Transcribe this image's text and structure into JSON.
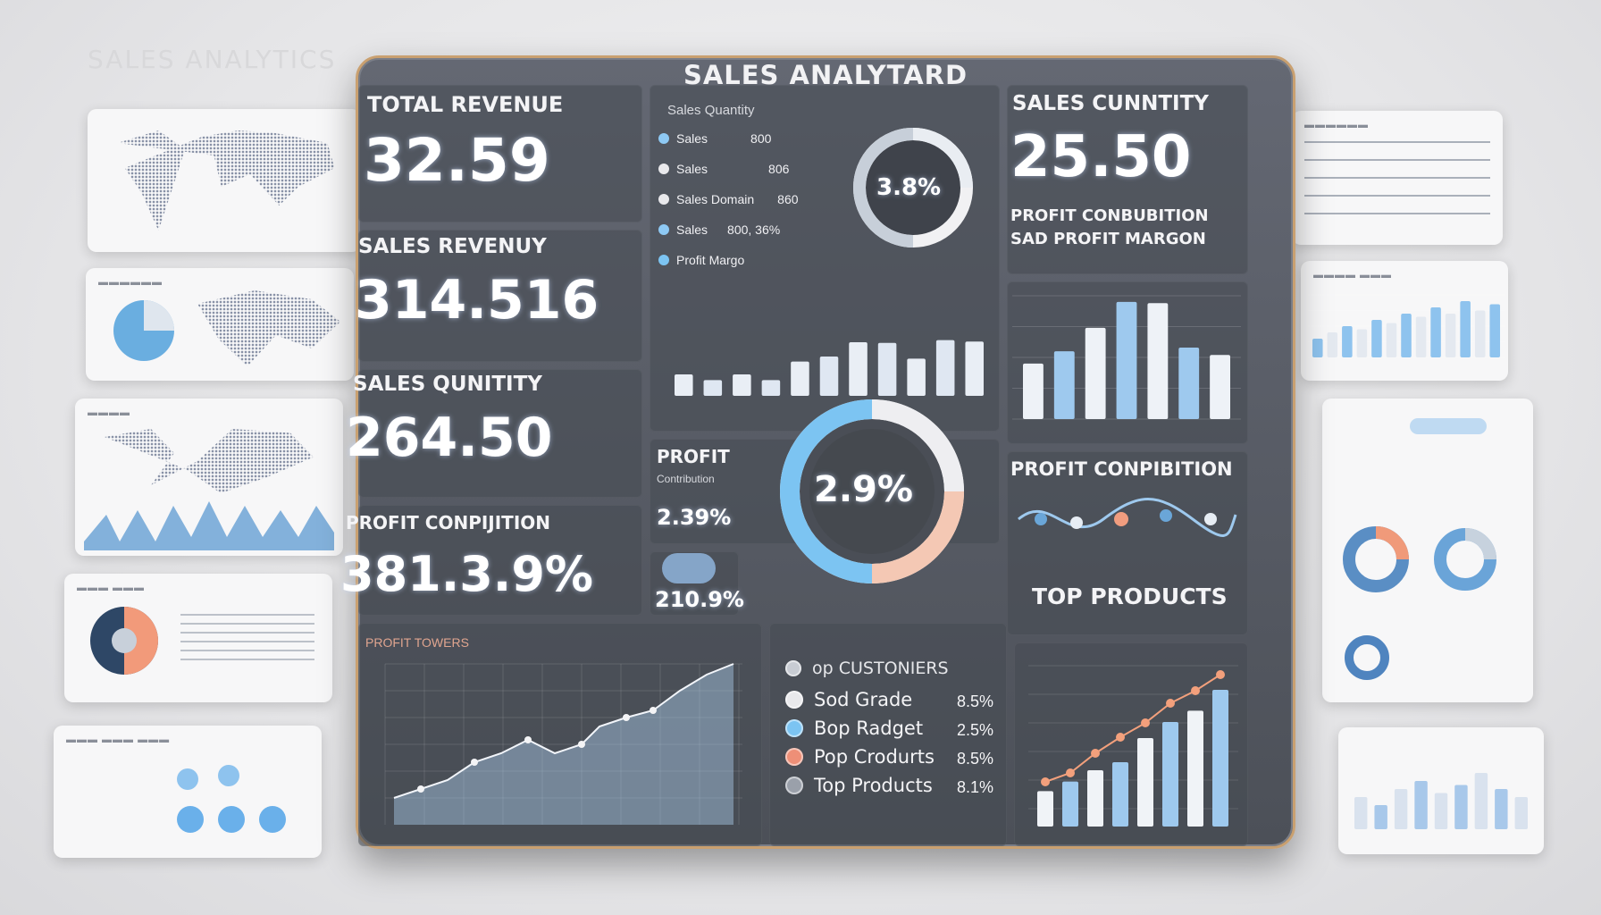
{
  "background_title": "SALES ANALYTICS",
  "dashboard": {
    "title": "SALES ANALYTARD",
    "kpis": [
      {
        "label": "TOTAL REVENUE",
        "value": "32.59"
      },
      {
        "label": "SALES REVENUY",
        "value": "314.516"
      },
      {
        "label": "SALES QUNITITY",
        "value": "264.50"
      },
      {
        "label": "PROFIT CONPIJITION",
        "value": "381.3.9%"
      }
    ],
    "sales_quantity_panel": {
      "heading": "Sales Quantity",
      "rows": [
        {
          "label": "Sales",
          "value": "800"
        },
        {
          "label": "Sales",
          "value": "806"
        },
        {
          "label": "Sales Domain",
          "value": "860"
        },
        {
          "label": "Sales",
          "value": "800, 36%"
        }
      ],
      "footer": "Profit Margo",
      "donut_value": "3.8%"
    },
    "right_kpi": {
      "label": "SALES CUNNTITY",
      "value": "25.50",
      "sub1": "PROFIT CONBUBITION",
      "sub2": "SAD PROFIT MARGON"
    },
    "profit_panel": {
      "label": "PROFIT",
      "sub": "Contribution",
      "value1": "2.39%",
      "value2": "210.9%",
      "donut_value": "2.9%"
    },
    "profit_compilation_label": "PROFIT CONPIBITION",
    "top_products_label": "TOP PRODUCTS",
    "line_chart_title": "PROFIT TOWERS",
    "top_customers": {
      "title": "op CUSTONIERS",
      "rows": [
        {
          "label": "Sod Grade",
          "pct": "8.5%",
          "color": "#e9e9ec"
        },
        {
          "label": "Bop Radget",
          "pct": "2.5%",
          "color": "#7cc4f2"
        },
        {
          "label": "Pop Crodurts",
          "pct": "8.5%",
          "color": "#ee8f77"
        },
        {
          "label": "Top Products",
          "pct": "8.1%",
          "color": "#9aa0aa"
        }
      ]
    }
  },
  "colors": {
    "accent_blue": "#7cc4f2",
    "accent_orange": "#f3a07c",
    "panel_gray": "#555962"
  }
}
